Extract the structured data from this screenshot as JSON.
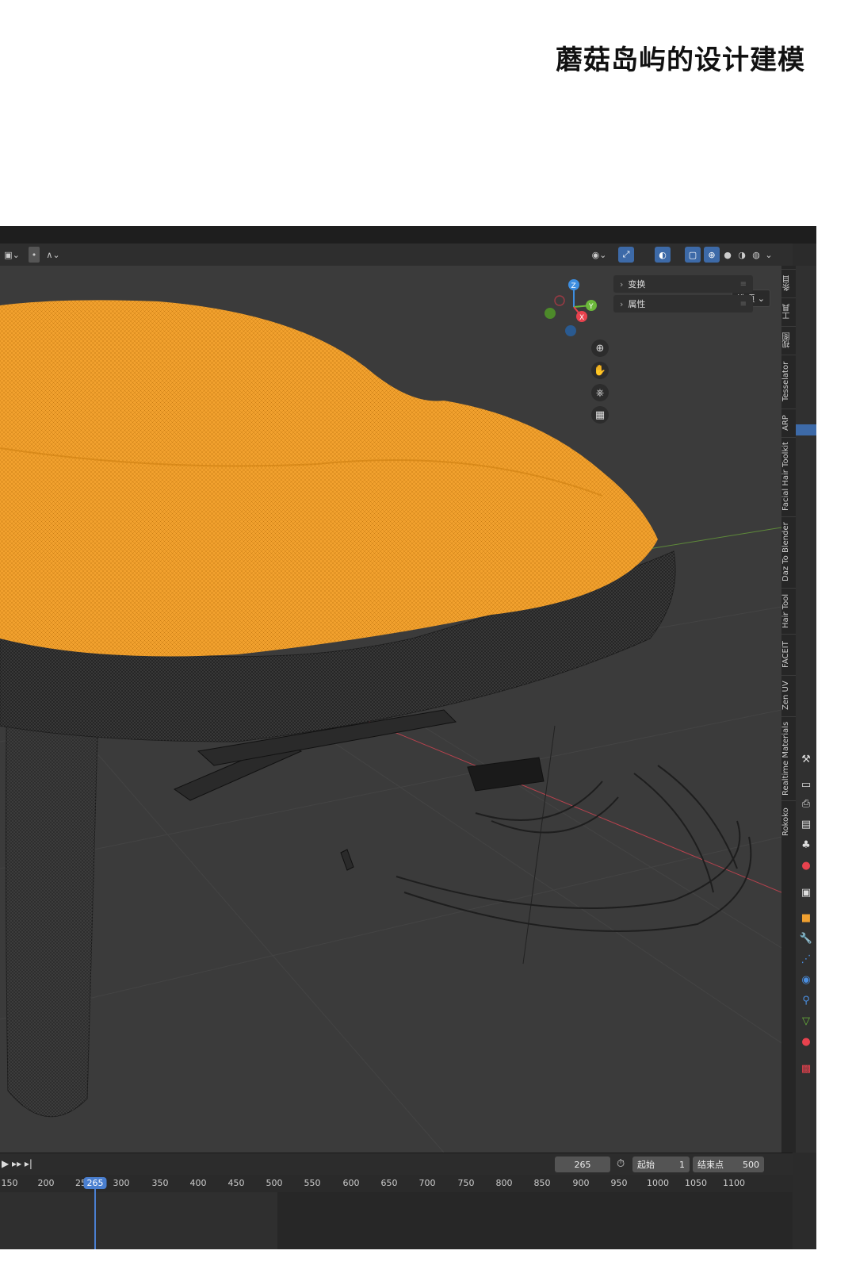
{
  "page": {
    "title": "蘑菇岛屿的设计建模"
  },
  "header": {
    "options_label": "选项 ⌄"
  },
  "n_panel": {
    "items": [
      {
        "label": "变换"
      },
      {
        "label": "属性"
      }
    ]
  },
  "gizmo": {
    "z": "Z",
    "y": "Y",
    "x": "X"
  },
  "side_tabs": [
    "条目",
    "工具",
    "视图",
    "Tesselator",
    "ARP",
    "Facial Hair Toolkit",
    "Daz To Blender",
    "Hair Tool",
    "FACEIT",
    "Zen UV",
    "Realtime Materials",
    "Rokoko"
  ],
  "timeline": {
    "current_frame": "265",
    "start_label": "起始",
    "start_value": "1",
    "end_label": "结束点",
    "end_value": "500",
    "ruler": [
      "150",
      "200",
      "25",
      "300",
      "350",
      "400",
      "450",
      "500",
      "550",
      "600",
      "650",
      "700",
      "750",
      "800",
      "850",
      "900",
      "950",
      "1000",
      "1050",
      "1100"
    ]
  },
  "colors": {
    "selection": "#f0a030",
    "viewport_bg": "#3b3b3b",
    "accent_blue": "#4a7fd0",
    "axis_x": "#e8424e",
    "axis_y": "#6bb83a",
    "axis_z": "#3d8ee0"
  },
  "icons": [
    "zoom-icon",
    "pan-hand-icon",
    "camera-icon",
    "grid-view-icon",
    "clock-icon"
  ]
}
